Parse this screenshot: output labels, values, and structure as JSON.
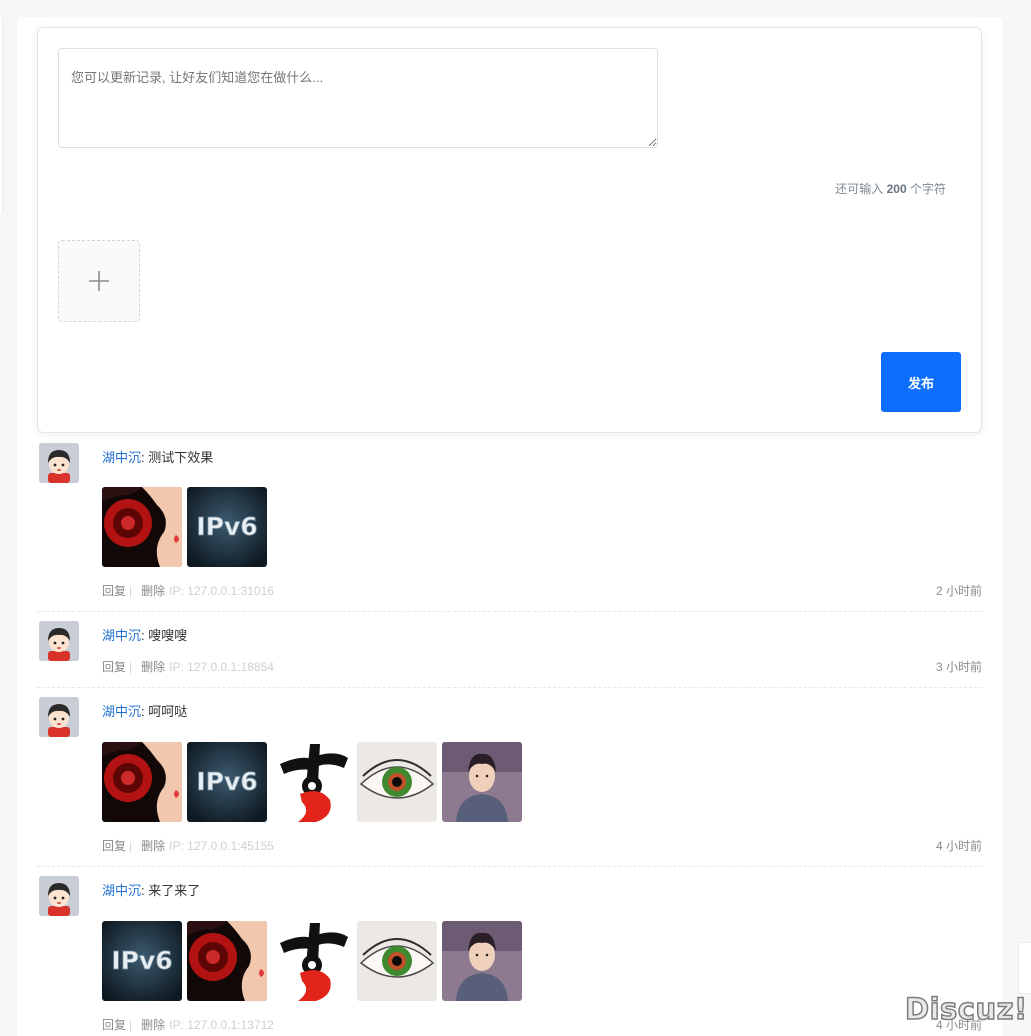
{
  "composer": {
    "placeholder": "您可以更新记录, 让好友们知道您在做什么...",
    "counter_prefix": "还可输入",
    "counter_value": "200",
    "counter_suffix": "个字符",
    "publish_label": "发布"
  },
  "feed": [
    {
      "author": "湖中沉",
      "separator": ": ",
      "text": "测试下效果",
      "images": [
        "headphones-girl",
        "ipv6"
      ],
      "reply_label": "回复",
      "delete_label": "删除",
      "ip": "IP: 127.0.0.1:31016",
      "time": "2 小时前"
    },
    {
      "author": "湖中沉",
      "separator": ": ",
      "text": "嗖嗖嗖",
      "images": [],
      "reply_label": "回复",
      "delete_label": "删除",
      "ip": "IP: 127.0.0.1:18854",
      "time": "3 小时前"
    },
    {
      "author": "湖中沉",
      "separator": ": ",
      "text": "呵呵哒",
      "images": [
        "headphones-girl",
        "ipv6",
        "calligraphy-logo",
        "green-eye",
        "actor-portrait"
      ],
      "reply_label": "回复",
      "delete_label": "删除",
      "ip": "IP: 127.0.0.1:45155",
      "time": "4 小时前"
    },
    {
      "author": "湖中沉",
      "separator": ": ",
      "text": "来了来了",
      "images": [
        "ipv6",
        "headphones-girl",
        "calligraphy-logo",
        "green-eye",
        "actor-portrait"
      ],
      "reply_label": "回复",
      "delete_label": "删除",
      "ip": "IP: 127.0.0.1:13712",
      "time": "4 小时前"
    }
  ],
  "watermark": "Discuz!"
}
